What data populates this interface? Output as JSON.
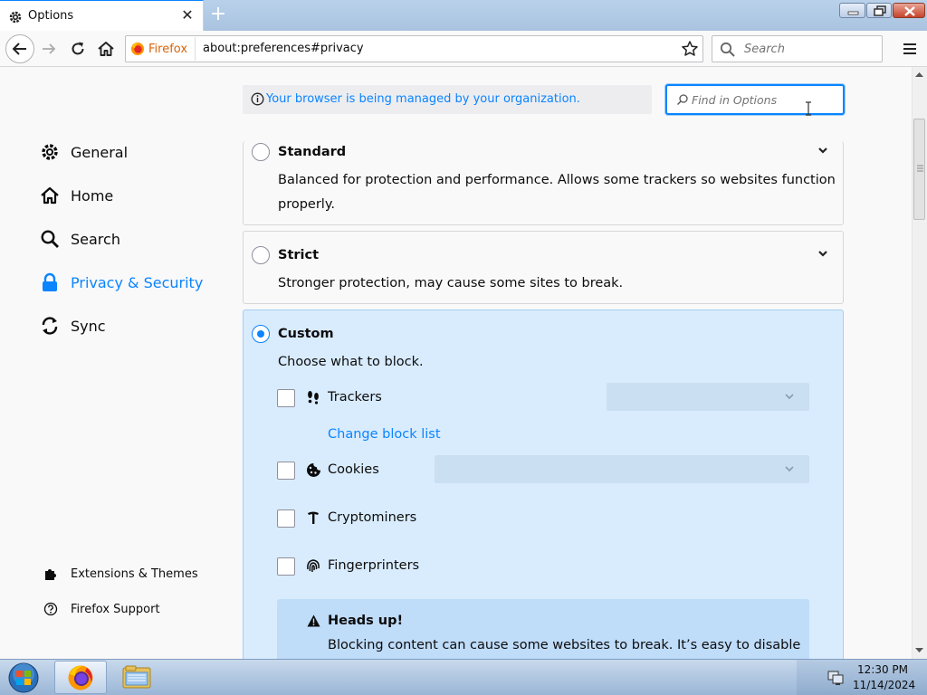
{
  "tab": {
    "title": "Options"
  },
  "identity": {
    "label": "Firefox"
  },
  "url": "about:preferences#privacy",
  "search": {
    "placeholder": "Search"
  },
  "managed_notice": "Your browser is being managed by your organization.",
  "find": {
    "placeholder": "Find in Options"
  },
  "sidebar": {
    "items": [
      {
        "label": "General",
        "icon": "gear-icon"
      },
      {
        "label": "Home",
        "icon": "home-icon"
      },
      {
        "label": "Search",
        "icon": "search-icon"
      },
      {
        "label": "Privacy & Security",
        "icon": "lock-icon",
        "selected": true
      },
      {
        "label": "Sync",
        "icon": "sync-icon"
      }
    ],
    "footer": [
      {
        "label": "Extensions & Themes",
        "icon": "puzzle-icon"
      },
      {
        "label": "Firefox Support",
        "icon": "help-icon"
      }
    ]
  },
  "standard": {
    "title": "Standard",
    "desc1": "Balanced for protection and performance. Allows some trackers so websites function",
    "desc2": "properly."
  },
  "strict": {
    "title": "Strict",
    "desc": "Stronger protection, may cause some sites to break."
  },
  "custom": {
    "title": "Custom",
    "desc": "Choose what to block.",
    "rows": [
      {
        "label": "Trackers",
        "icon": "trackers-icon"
      },
      {
        "label": "Cookies",
        "icon": "cookie-icon"
      },
      {
        "label": "Cryptominers",
        "icon": "cryptominer-icon"
      },
      {
        "label": "Fingerprinters",
        "icon": "fingerprint-icon"
      }
    ],
    "change_block_list": "Change block list",
    "headsup_title": "Heads up!",
    "headsup_body": "Blocking content can cause some websites to break. It’s easy to disable"
  },
  "taskbar": {
    "time": "12:30 PM",
    "date": "11/14/2024"
  },
  "colors": {
    "accent": "#0a84ff",
    "custom_bg": "#d9ecfd",
    "headsup_bg": "#bfdcf9"
  }
}
